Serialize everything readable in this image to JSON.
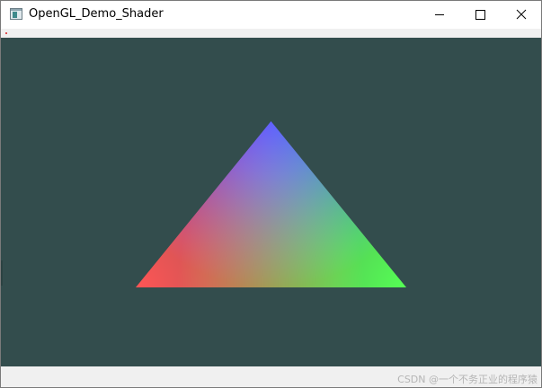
{
  "window": {
    "title": "OpenGL_Demo_Shader",
    "icon": "app-window-icon"
  },
  "title_controls": {
    "minimize_icon": "minimize-icon",
    "maximize_icon": "maximize-icon",
    "close_icon": "close-icon"
  },
  "gl_view": {
    "clear_color": "#334d4d",
    "shape": "triangle",
    "vertex_colors": {
      "top": "#0000ff",
      "bottom_left": "#ff0000",
      "bottom_right": "#00ff00"
    }
  },
  "statusbar": {
    "watermark": "CSDN @一个不务正业的程序猿"
  }
}
